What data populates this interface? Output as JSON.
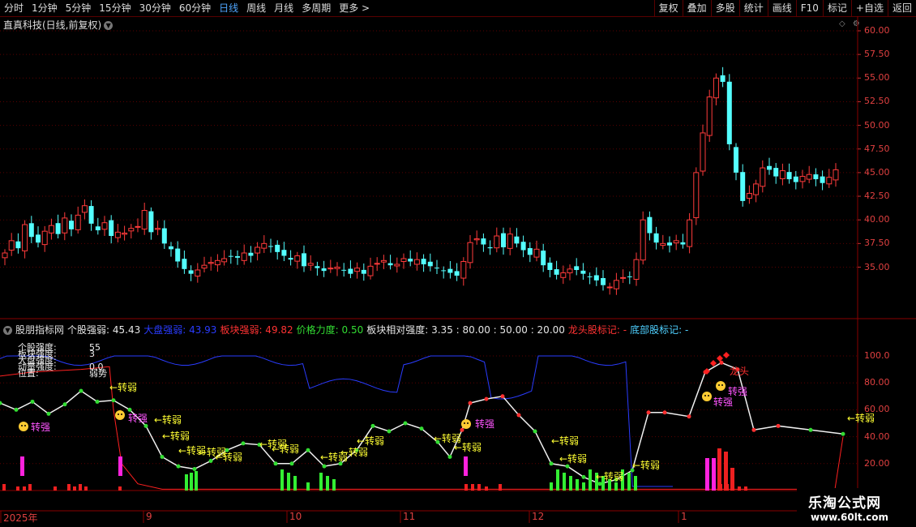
{
  "toolbar": {
    "periods": [
      "分时",
      "1分钟",
      "5分钟",
      "15分钟",
      "30分钟",
      "60分钟",
      "日线",
      "周线",
      "月线",
      "多周期",
      "更多 >"
    ],
    "active_period": "日线",
    "right_buttons": [
      "复权",
      "叠加",
      "多股",
      "统计",
      "画线",
      "F10",
      "标记",
      "+自选",
      "返回"
    ]
  },
  "main_chart": {
    "title": "直真科技(日线,前复权)",
    "price_ticks": [
      "60.00",
      "57.50",
      "55.00",
      "52.50",
      "50.00",
      "47.50",
      "45.00",
      "42.50",
      "40.00",
      "37.50",
      "35.00"
    ],
    "up_color": "#ff3b3b",
    "down_color": "#54ffff"
  },
  "indicator": {
    "name": "股朋指标网",
    "items": [
      {
        "label": "个股强弱:",
        "value": "45.43",
        "color": "#e6e6e6"
      },
      {
        "label": "大盘强弱:",
        "value": "43.93",
        "color": "#2a3cff"
      },
      {
        "label": "板块强弱:",
        "value": "49.82",
        "color": "#ff3333"
      },
      {
        "label": "价格力度:",
        "value": "0.50",
        "color": "#33dd33"
      },
      {
        "label": "板块相对强度:",
        "value": "3.35 : 80.00 : 50.00 : 20.00",
        "color": "#e6e6e6"
      },
      {
        "label": "龙头股标记:",
        "value": "-",
        "color": "#ff3333"
      },
      {
        "label": "底部股标记:",
        "value": "-",
        "color": "#4fd0ff"
      }
    ],
    "ticks": [
      "100.0",
      "80.00",
      "60.00",
      "40.00",
      "20.00"
    ],
    "info_rows": [
      {
        "label": "个股强度:",
        "value": "55"
      },
      {
        "label": "板块强度:",
        "value": "3"
      },
      {
        "label": "大盘强度:",
        "value": ""
      },
      {
        "label": "动量强度:",
        "value": "0.0"
      },
      {
        "label": "位置:",
        "value": "弱势"
      }
    ],
    "labels": {
      "zhuanruo": "转弱",
      "zhuanqiang": "转强",
      "longtou": "龙头"
    }
  },
  "date_axis": {
    "labels": [
      "2025年",
      "9",
      "10",
      "11",
      "12",
      "1"
    ]
  },
  "watermark": {
    "title": "乐淘公式网",
    "url": "www.60lt.com"
  }
}
